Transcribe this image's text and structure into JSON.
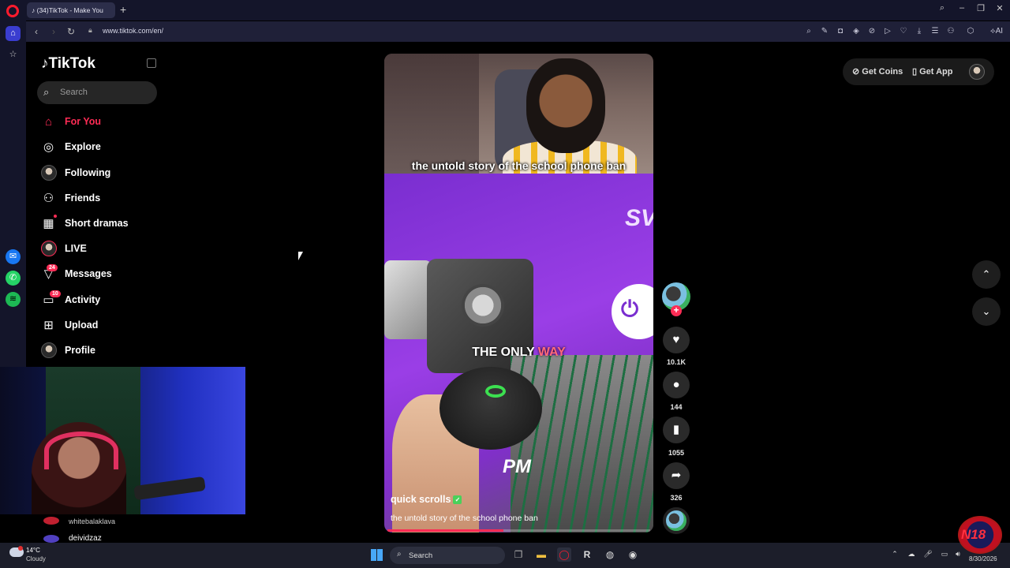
{
  "browser": {
    "tab_title": "(34)TikTok - Make You",
    "url": "www.tiktok.com/en/",
    "new_tab_symbol": "+"
  },
  "tiktok": {
    "logo": "TikTok",
    "search_placeholder": "Search",
    "nav": [
      {
        "label": "For You",
        "icon": "home-icon",
        "active": true
      },
      {
        "label": "Explore",
        "icon": "compass-icon"
      },
      {
        "label": "Following",
        "icon": "following-avatar-icon"
      },
      {
        "label": "Friends",
        "icon": "friends-icon"
      },
      {
        "label": "Short dramas",
        "icon": "film-icon"
      },
      {
        "label": "LIVE",
        "icon": "live-avatar-icon"
      },
      {
        "label": "Messages",
        "icon": "messages-icon",
        "badge": "24"
      },
      {
        "label": "Activity",
        "icon": "activity-icon",
        "badge": "10"
      },
      {
        "label": "Upload",
        "icon": "upload-icon"
      },
      {
        "label": "Profile",
        "icon": "profile-avatar-icon"
      }
    ],
    "get_coins": "Get Coins",
    "get_app": "Get App"
  },
  "video": {
    "caption_top": "the untold story of the school phone ban",
    "overlay_main": "THE ONLY",
    "overlay_highlight": "WAY",
    "overlay_pm": "PM",
    "overlay_corner": "SV",
    "author": "quick scrolls",
    "description": "the untold story of the school phone ban",
    "progress": 0.44
  },
  "actions": {
    "likes": "10.1K",
    "comments": "144",
    "saves": "1055",
    "shares": "326"
  },
  "chat": {
    "names": [
      "whitebalaklava",
      "deividzaz"
    ]
  },
  "taskbar": {
    "temperature": "14°C",
    "condition": "Cloudy",
    "search": "Search",
    "date": "8/30/2026",
    "corner_logo": "N18"
  },
  "colors": {
    "accent": "#fe2c55",
    "browser_bg": "#14152a"
  }
}
